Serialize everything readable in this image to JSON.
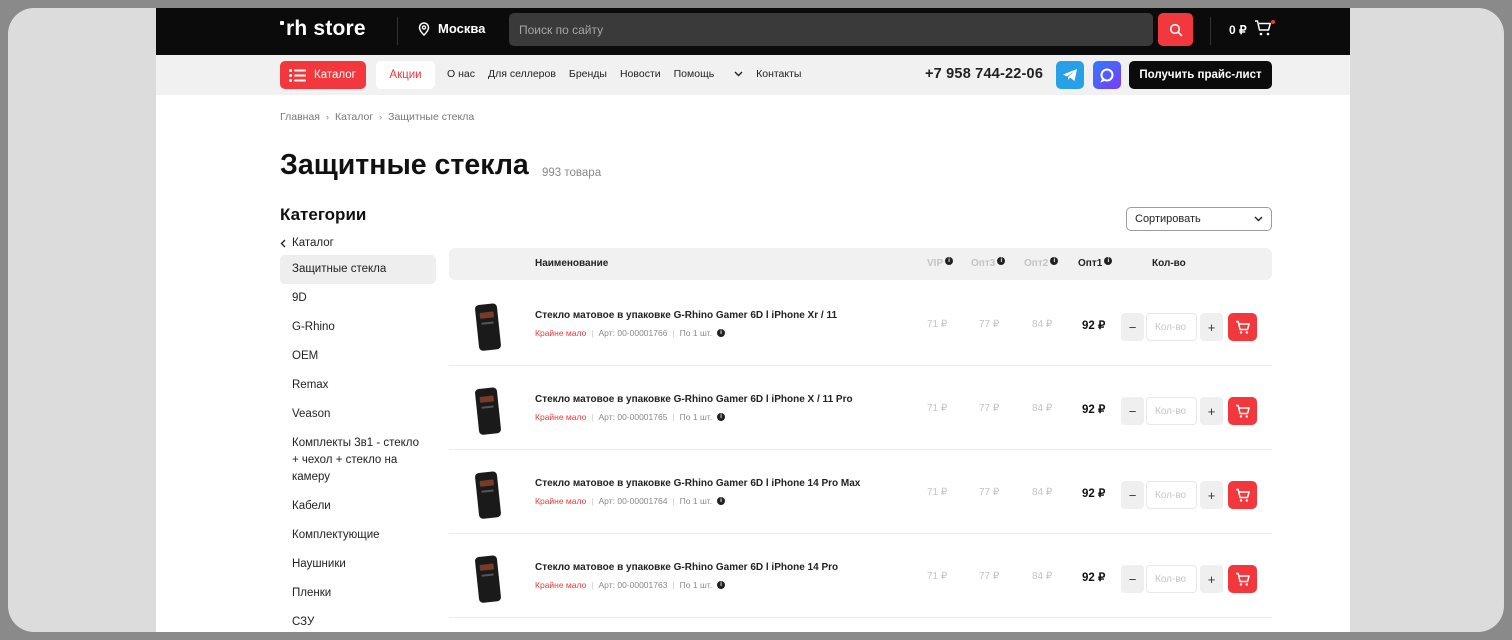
{
  "header": {
    "logo": "rh store",
    "city": "Москва",
    "search_placeholder": "Поиск по сайту",
    "cart_total": "0 ₽"
  },
  "nav": {
    "catalog_label": "Каталог",
    "promo_label": "Акции",
    "links": [
      "О нас",
      "Для селлеров",
      "Бренды",
      "Новости",
      "Помощь",
      "Контакты"
    ],
    "phone": "+7 958 744-22-06",
    "price_list_label": "Получить прайс-лист"
  },
  "breadcrumbs": [
    "Главная",
    "Каталог",
    "Защитные стекла"
  ],
  "page": {
    "title": "Защитные стекла",
    "count": "993 товара",
    "categories_title": "Категории",
    "sort_label": "Сортировать"
  },
  "sidebar": {
    "back_label": "Каталог",
    "items": [
      "Защитные стекла",
      "9D",
      "G-Rhino",
      "OEM",
      "Remax",
      "Veason",
      "Комплекты 3в1 - стекло + чехол + стекло на камеру",
      "Кабели",
      "Комплектующие",
      "Наушники",
      "Пленки",
      "СЗУ"
    ]
  },
  "table": {
    "headers": {
      "name": "Наименование",
      "vip": "VIP",
      "opt3": "Опт3",
      "opt2": "Опт2",
      "opt1": "Опт1",
      "qty": "Кол-во"
    },
    "qty_placeholder": "Кол-во",
    "rows": [
      {
        "name": "Стекло матовое в упаковке G-Rhino Gamer 6D l iPhone Xr / 11",
        "stock": "Крайне мало",
        "sku": "Арт: 00-00001766",
        "unit": "По 1 шт.",
        "vip": "71 ₽",
        "opt3": "77 ₽",
        "opt2": "84 ₽",
        "opt1": "92 ₽"
      },
      {
        "name": "Стекло матовое в упаковке G-Rhino Gamer 6D l iPhone X / 11 Pro",
        "stock": "Крайне мало",
        "sku": "Арт: 00-00001765",
        "unit": "По 1 шт.",
        "vip": "71 ₽",
        "opt3": "77 ₽",
        "opt2": "84 ₽",
        "opt1": "92 ₽"
      },
      {
        "name": "Стекло матовое в упаковке G-Rhino Gamer 6D l iPhone 14 Pro Max",
        "stock": "Крайне мало",
        "sku": "Арт: 00-00001764",
        "unit": "По 1 шт.",
        "vip": "71 ₽",
        "opt3": "77 ₽",
        "opt2": "84 ₽",
        "opt1": "92 ₽"
      },
      {
        "name": "Стекло матовое в упаковке G-Rhino Gamer 6D l iPhone 14 Pro",
        "stock": "Крайне мало",
        "sku": "Арт: 00-00001763",
        "unit": "По 1 шт.",
        "vip": "71 ₽",
        "opt3": "77 ₽",
        "opt2": "84 ₽",
        "opt1": "92 ₽"
      }
    ]
  },
  "colors": {
    "accent": "#f2383c",
    "dark": "#0b0b0b",
    "telegram": "#27a0e8"
  }
}
